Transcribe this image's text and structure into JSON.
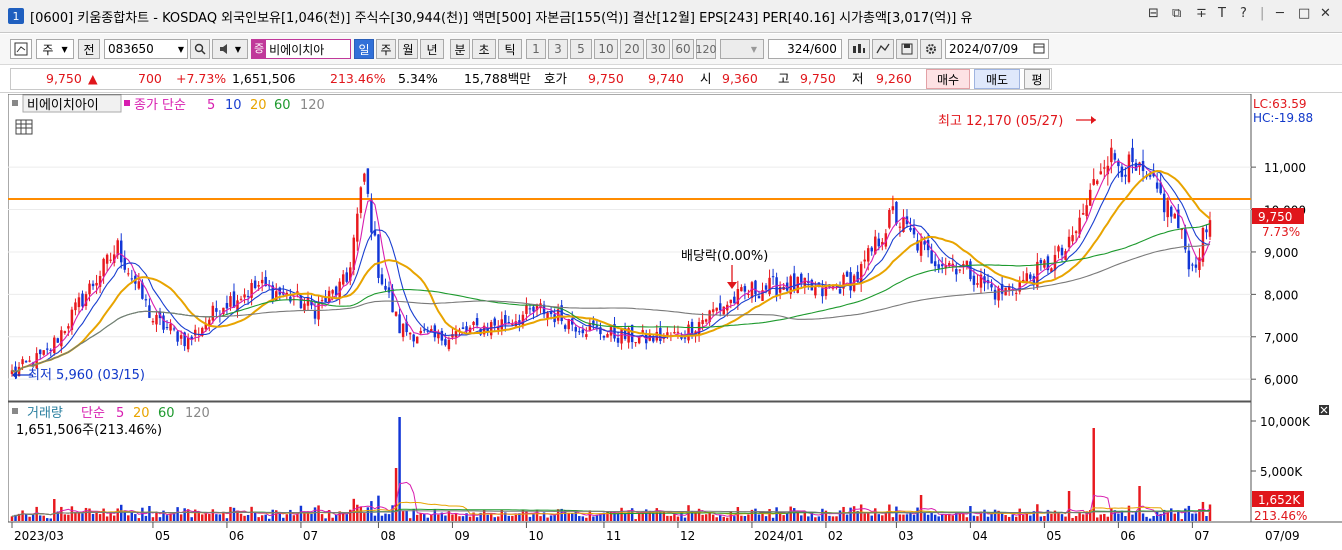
{
  "title_bar": {
    "number": "1",
    "title": "[0600] 키움종합차트 - KOSDAQ 외국인보유[1,046(천)] 주식수[30,944(천)] 액면[500] 자본금[155(억)] 결산[12월] EPS[243] PER[40.16] 시가총액[3,017(억)] 유",
    "window_icons": [
      "⊟",
      "⧉",
      "∓",
      "T",
      "?",
      "|",
      "─",
      "□",
      "✕"
    ]
  },
  "toolbar1": {
    "market_select": "주",
    "prev_label": "전",
    "code_value": "083650",
    "stock_name": "비에이치아",
    "period_buttons": [
      "일",
      "주",
      "월",
      "년",
      "분",
      "초",
      "틱"
    ],
    "active_period": "일",
    "intervals": [
      "1",
      "3",
      "5",
      "10",
      "20",
      "30",
      "60",
      "120"
    ],
    "count_value": "324",
    "count_max": "/600",
    "date_value": "2024/07/09"
  },
  "quote": {
    "price": "9,750",
    "arrow": "▲",
    "change": "700",
    "change_pct": "+7.73%",
    "volume": "1,651,506",
    "vol_ratio": "213.46%",
    "turnover": "5.34%",
    "amount": "15,788백만",
    "bid_label": "호가",
    "ask": "9,750",
    "bid": "9,740",
    "open_label": "시",
    "open": "9,360",
    "high_label": "고",
    "high": "9,750",
    "low_label": "저",
    "low": "9,260",
    "buy_label": "매수",
    "sell_label": "매도",
    "flat_label": "평"
  },
  "chart_data": [
    {
      "type": "line",
      "panel": "price",
      "name_label": "비에이치아이",
      "ma_label": "종가 단순",
      "ma_periods": [
        "5",
        "10",
        "20",
        "60",
        "120"
      ],
      "ma_colors": [
        "#d81eb0",
        "#1a3fd0",
        "#e8a400",
        "#1e9a2e",
        "#7a7a7a"
      ],
      "lc_label": "LC:63.59",
      "hc_label": "HC:-19.88",
      "yticks": [
        "11,000",
        "10,000",
        "9,000",
        "8,000",
        "7,000",
        "6,000"
      ],
      "ytick_values": [
        11000,
        10000,
        9000,
        8000,
        7000,
        6000
      ],
      "ylim": [
        5580,
        12630
      ],
      "hline": 10250,
      "last_price_tag": "9,750",
      "last_pct_tag": "7.73%",
      "annotations": {
        "high": "최고 12,170 (05/27)",
        "low": "최저 5,960 (03/15)",
        "dividend": "배당락(0.00%)"
      },
      "x_labels": [
        "2023/03",
        "05",
        "06",
        "07",
        "08",
        "09",
        "10",
        "11",
        "12",
        "2024/01",
        "02",
        "03",
        "04",
        "05",
        "06",
        "07",
        "07/09"
      ],
      "x_months_index": [
        0,
        40,
        61,
        82,
        104,
        125,
        146,
        168,
        189,
        210,
        231,
        251,
        272,
        293,
        314,
        335,
        340
      ],
      "close_keypoints": [
        [
          0,
          6150
        ],
        [
          10,
          6600
        ],
        [
          20,
          7900
        ],
        [
          30,
          9100
        ],
        [
          40,
          7400
        ],
        [
          50,
          6900
        ],
        [
          60,
          7800
        ],
        [
          70,
          8200
        ],
        [
          80,
          7900
        ],
        [
          86,
          7650
        ],
        [
          95,
          8300
        ],
        [
          100,
          10800
        ],
        [
          104,
          8600
        ],
        [
          110,
          7200
        ],
        [
          120,
          6950
        ],
        [
          130,
          7150
        ],
        [
          140,
          7350
        ],
        [
          150,
          7650
        ],
        [
          160,
          7300
        ],
        [
          170,
          7050
        ],
        [
          180,
          6950
        ],
        [
          190,
          7050
        ],
        [
          200,
          7650
        ],
        [
          210,
          8100
        ],
        [
          220,
          8250
        ],
        [
          230,
          8050
        ],
        [
          240,
          8400
        ],
        [
          250,
          9900
        ],
        [
          260,
          8900
        ],
        [
          270,
          8650
        ],
        [
          280,
          8000
        ],
        [
          290,
          8450
        ],
        [
          300,
          9100
        ],
        [
          305,
          10100
        ],
        [
          310,
          11300
        ],
        [
          315,
          11100
        ],
        [
          320,
          10800
        ],
        [
          325,
          10400
        ],
        [
          330,
          9800
        ],
        [
          335,
          8600
        ],
        [
          340,
          9750
        ]
      ]
    },
    {
      "type": "bar",
      "panel": "volume",
      "label": "거래량",
      "ma_label": "단순",
      "ma_periods": [
        "5",
        "20",
        "60",
        "120"
      ],
      "ma_colors": [
        "#d81eb0",
        "#e8a400",
        "#1e9a2e",
        "#7a7a7a"
      ],
      "current": "1,651,506주(213.46%)",
      "yticks": [
        "10,000K",
        "5,000K"
      ],
      "ytick_values": [
        10000,
        5000
      ],
      "ylim": [
        0,
        11500
      ],
      "last_volume_tag": "1,652K",
      "last_pct_tag": "213.46%"
    }
  ]
}
